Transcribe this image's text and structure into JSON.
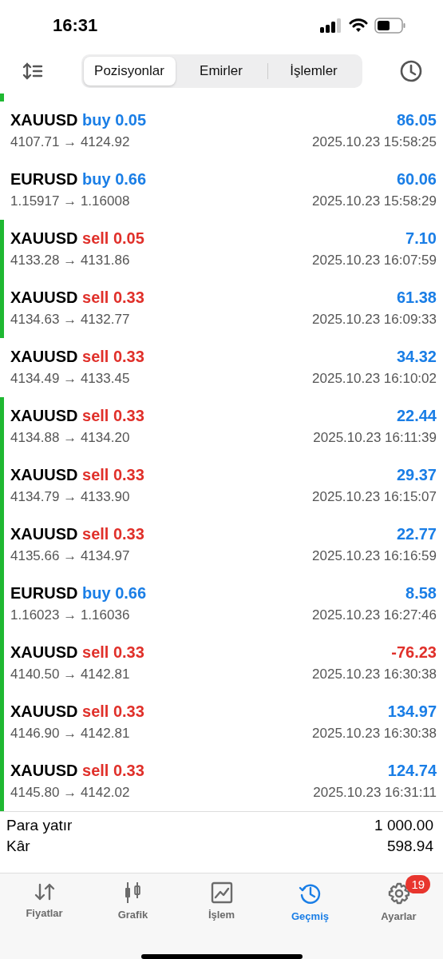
{
  "status_bar": {
    "time": "16:31"
  },
  "segments": [
    {
      "label": "Pozisyonlar",
      "selected": true
    },
    {
      "label": "Emirler",
      "selected": false
    },
    {
      "label": "İşlemler",
      "selected": false
    }
  ],
  "list": {
    "top_marked": true,
    "rows": [
      {
        "symbol": "XAUUSD",
        "side": "buy",
        "volume": "0.05",
        "prices": "4107.71 → 4124.92",
        "profit": "86.05",
        "loss": false,
        "time": "2025.10.23 15:58:25",
        "marked": false
      },
      {
        "symbol": "EURUSD",
        "side": "buy",
        "volume": "0.66",
        "prices": "1.15917 → 1.16008",
        "profit": "60.06",
        "loss": false,
        "time": "2025.10.23 15:58:29",
        "marked": false
      },
      {
        "symbol": "XAUUSD",
        "side": "sell",
        "volume": "0.05",
        "prices": "4133.28 → 4131.86",
        "profit": "7.10",
        "loss": false,
        "time": "2025.10.23 16:07:59",
        "marked": true
      },
      {
        "symbol": "XAUUSD",
        "side": "sell",
        "volume": "0.33",
        "prices": "4134.63 → 4132.77",
        "profit": "61.38",
        "loss": false,
        "time": "2025.10.23 16:09:33",
        "marked": true
      },
      {
        "symbol": "XAUUSD",
        "side": "sell",
        "volume": "0.33",
        "prices": "4134.49 → 4133.45",
        "profit": "34.32",
        "loss": false,
        "time": "2025.10.23 16:10:02",
        "marked": false
      },
      {
        "symbol": "XAUUSD",
        "side": "sell",
        "volume": "0.33",
        "prices": "4134.88 → 4134.20",
        "profit": "22.44",
        "loss": false,
        "time": "2025.10.23 16:11:39",
        "marked": true
      },
      {
        "symbol": "XAUUSD",
        "side": "sell",
        "volume": "0.33",
        "prices": "4134.79 → 4133.90",
        "profit": "29.37",
        "loss": false,
        "time": "2025.10.23 16:15:07",
        "marked": true
      },
      {
        "symbol": "XAUUSD",
        "side": "sell",
        "volume": "0.33",
        "prices": "4135.66 → 4134.97",
        "profit": "22.77",
        "loss": false,
        "time": "2025.10.23 16:16:59",
        "marked": true
      },
      {
        "symbol": "EURUSD",
        "side": "buy",
        "volume": "0.66",
        "prices": "1.16023 → 1.16036",
        "profit": "8.58",
        "loss": false,
        "time": "2025.10.23 16:27:46",
        "marked": true
      },
      {
        "symbol": "XAUUSD",
        "side": "sell",
        "volume": "0.33",
        "prices": "4140.50 → 4142.81",
        "profit": "-76.23",
        "loss": true,
        "time": "2025.10.23 16:30:38",
        "marked": true
      },
      {
        "symbol": "XAUUSD",
        "side": "sell",
        "volume": "0.33",
        "prices": "4146.90 → 4142.81",
        "profit": "134.97",
        "loss": false,
        "time": "2025.10.23 16:30:38",
        "marked": true
      },
      {
        "symbol": "XAUUSD",
        "side": "sell",
        "volume": "0.33",
        "prices": "4145.80 → 4142.02",
        "profit": "124.74",
        "loss": false,
        "time": "2025.10.23 16:31:11",
        "marked": true
      }
    ]
  },
  "summary": [
    {
      "label": "Para yatır",
      "value": "1 000.00"
    },
    {
      "label": "Kâr",
      "value": "598.94"
    }
  ],
  "tab_bar": [
    {
      "label": "Fiyatlar",
      "kind": "quotes",
      "selected": false
    },
    {
      "label": "Grafik",
      "kind": "chart",
      "selected": false
    },
    {
      "label": "İşlem",
      "kind": "trade",
      "selected": false
    },
    {
      "label": "Geçmiş",
      "kind": "history",
      "selected": true
    },
    {
      "label": "Ayarlar",
      "kind": "settings",
      "selected": false,
      "badge": "19"
    }
  ]
}
